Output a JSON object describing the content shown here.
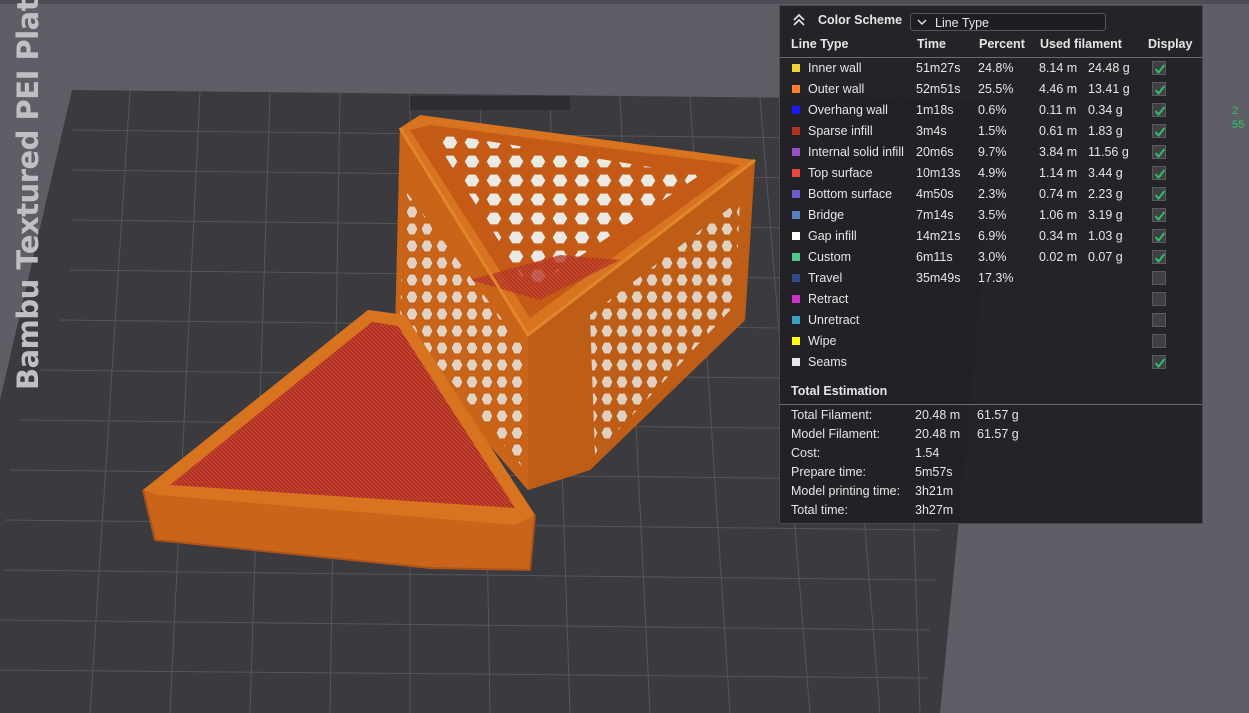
{
  "viewport": {
    "plate_label": "Bambu Textured PEI Plate",
    "colors": {
      "background": "#5e5f66",
      "plate": "#3a3a3f",
      "model": "#d2691e",
      "model_top": "#b8341f"
    }
  },
  "edge_readout": {
    "line1": "2",
    "line2": "55"
  },
  "legend": {
    "title": "Color Scheme",
    "dropdown_value": "Line Type",
    "headers": {
      "line_type": "Line Type",
      "time": "Time",
      "percent": "Percent",
      "used": "Used filament",
      "display": "Display"
    },
    "rows": [
      {
        "name": "Inner wall",
        "color": "#f5d13b",
        "time": "51m27s",
        "percent": "24.8%",
        "length": "8.14 m",
        "weight": "24.48 g",
        "display": true
      },
      {
        "name": "Outer wall",
        "color": "#ff7e2e",
        "time": "52m51s",
        "percent": "25.5%",
        "length": "4.46 m",
        "weight": "13.41 g",
        "display": true
      },
      {
        "name": "Overhang wall",
        "color": "#1a1af5",
        "time": "1m18s",
        "percent": "0.6%",
        "length": "0.11 m",
        "weight": "0.34 g",
        "display": true
      },
      {
        "name": "Sparse infill",
        "color": "#b03227",
        "time": "3m4s",
        "percent": "1.5%",
        "length": "0.61 m",
        "weight": "1.83 g",
        "display": true
      },
      {
        "name": "Internal solid infill",
        "color": "#9650c8",
        "time": "20m6s",
        "percent": "9.7%",
        "length": "3.84 m",
        "weight": "11.56 g",
        "display": true
      },
      {
        "name": "Top surface",
        "color": "#e8463f",
        "time": "10m13s",
        "percent": "4.9%",
        "length": "1.14 m",
        "weight": "3.44 g",
        "display": true
      },
      {
        "name": "Bottom surface",
        "color": "#6a5acd",
        "time": "4m50s",
        "percent": "2.3%",
        "length": "0.74 m",
        "weight": "2.23 g",
        "display": true
      },
      {
        "name": "Bridge",
        "color": "#5b7fbf",
        "time": "7m14s",
        "percent": "3.5%",
        "length": "1.06 m",
        "weight": "3.19 g",
        "display": true
      },
      {
        "name": "Gap infill",
        "color": "#ffffff",
        "time": "14m21s",
        "percent": "6.9%",
        "length": "0.34 m",
        "weight": "1.03 g",
        "display": true
      },
      {
        "name": "Custom",
        "color": "#4fc88a",
        "time": "6m11s",
        "percent": "3.0%",
        "length": "0.02 m",
        "weight": "0.07 g",
        "display": true
      },
      {
        "name": "Travel",
        "color": "#324a8c",
        "time": "35m49s",
        "percent": "17.3%",
        "length": "",
        "weight": "",
        "display": false
      },
      {
        "name": "Retract",
        "color": "#c832c8",
        "time": "",
        "percent": "",
        "length": "",
        "weight": "",
        "display": false
      },
      {
        "name": "Unretract",
        "color": "#3aa0c8",
        "time": "",
        "percent": "",
        "length": "",
        "weight": "",
        "display": false
      },
      {
        "name": "Wipe",
        "color": "#ffff00",
        "time": "",
        "percent": "",
        "length": "",
        "weight": "",
        "display": false
      },
      {
        "name": "Seams",
        "color": "#e6e6e6",
        "time": "",
        "percent": "",
        "length": "",
        "weight": "",
        "display": true
      }
    ],
    "total": {
      "title": "Total Estimation",
      "rows": [
        {
          "label": "Total Filament:",
          "v1": "20.48 m",
          "v2": "61.57 g"
        },
        {
          "label": "Model Filament:",
          "v1": "20.48 m",
          "v2": "61.57 g"
        },
        {
          "label": "Cost:",
          "v1": "1.54",
          "v2": ""
        },
        {
          "label": "Prepare time:",
          "v1": "5m57s",
          "v2": ""
        },
        {
          "label": "Model printing time:",
          "v1": "3h21m",
          "v2": ""
        },
        {
          "label": "Total time:",
          "v1": "3h27m",
          "v2": ""
        }
      ]
    }
  }
}
